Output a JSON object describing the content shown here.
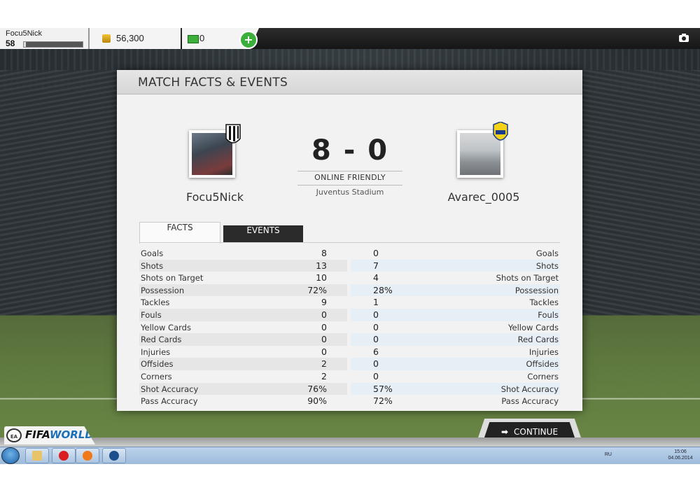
{
  "topbar": {
    "player_name": "Focu5Nick",
    "level": "58",
    "xp_progress": 0.03,
    "coins": "56,300",
    "points": "0",
    "add_label": "+",
    "icons": [
      "coin-icon",
      "fifa-points-icon",
      "camera-icon"
    ]
  },
  "modal": {
    "title": "MATCH FACTS & EVENTS",
    "home_team": "Focu5Nick",
    "away_team": "Avarec_0005",
    "score": "8 - 0",
    "match_type": "ONLINE FRIENDLY",
    "stadium": "Juventus Stadium",
    "tabs": [
      {
        "label": "FACTS",
        "active": true
      },
      {
        "label": "EVENTS",
        "active": false
      }
    ],
    "stats": [
      {
        "label": "Goals",
        "home": "8",
        "away": "0"
      },
      {
        "label": "Shots",
        "home": "13",
        "away": "7"
      },
      {
        "label": "Shots on Target",
        "home": "10",
        "away": "4"
      },
      {
        "label": "Possession",
        "home": "72%",
        "away": "28%"
      },
      {
        "label": "Tackles",
        "home": "9",
        "away": "1"
      },
      {
        "label": "Fouls",
        "home": "0",
        "away": "0"
      },
      {
        "label": "Yellow Cards",
        "home": "0",
        "away": "0"
      },
      {
        "label": "Red Cards",
        "home": "0",
        "away": "0"
      },
      {
        "label": "Injuries",
        "home": "0",
        "away": "6"
      },
      {
        "label": "Offsides",
        "home": "2",
        "away": "0"
      },
      {
        "label": "Corners",
        "home": "2",
        "away": "0"
      },
      {
        "label": "Shot Accuracy",
        "home": "76%",
        "away": "57%"
      },
      {
        "label": "Pass Accuracy",
        "home": "90%",
        "away": "72%"
      }
    ]
  },
  "continue_label": "CONTINUE",
  "logo": {
    "ea": "EA",
    "fifa": "FIFA",
    "world": "WORLD"
  },
  "taskbar": {
    "language": "RU",
    "time": "15:06",
    "date": "04.06.2014"
  },
  "colors": {
    "accent_green": "#3cae3c",
    "world_blue": "#1d70b7",
    "events_tab": "#2b2b2b"
  }
}
